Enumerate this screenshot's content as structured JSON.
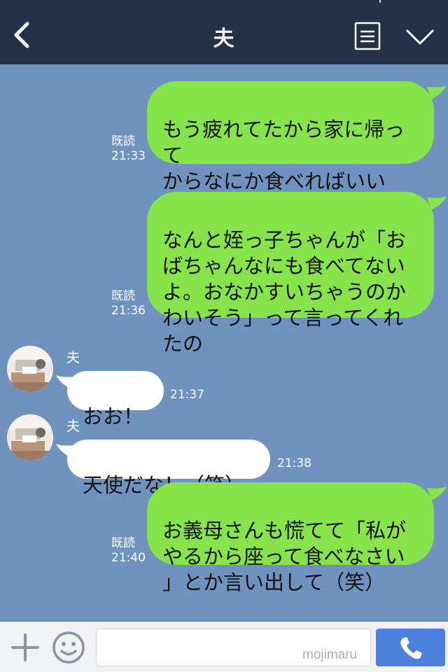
{
  "header": {
    "title": "夫",
    "icons": {
      "back": "chevron-left-icon",
      "menu": "menu-icon",
      "more": "chevron-down-icon"
    }
  },
  "messages": [
    {
      "side": "sent",
      "text": "もう疲れてたから家に帰って\nからなにか食べればいい\nかなって思ってたらね",
      "read": "既読",
      "time": "21:33"
    },
    {
      "side": "sent",
      "text": "なんと姪っ子ちゃんが「お\nばちゃんなにも食べてない\nよ。おなかすいちゃうのか\nわいそう」って言ってくれ\nたの",
      "read": "既読",
      "time": "21:36"
    },
    {
      "side": "received",
      "sender": "夫",
      "text": "おお！",
      "time": "21:37"
    },
    {
      "side": "received",
      "sender": "夫",
      "text": "天使だな！（笑）",
      "time": "21:38"
    },
    {
      "side": "sent",
      "text": "お義母さんも慌てて「私が\nやるから座って食べなさい\n」とか言い出して（笑）",
      "read": "既読",
      "time": "21:40"
    }
  ],
  "footer": {
    "input_value": "",
    "watermark": "mojimaru",
    "icons": {
      "plus": "plus-icon",
      "emoji": "emoji-icon",
      "call": "phone-icon"
    }
  },
  "colors": {
    "header_bg": "#243148",
    "chat_bg": "#7092bf",
    "sent_bubble": "#86e34a",
    "received_bubble": "#ffffff",
    "footer_bg": "#eff1f4",
    "call_button": "#4d7fdc"
  }
}
